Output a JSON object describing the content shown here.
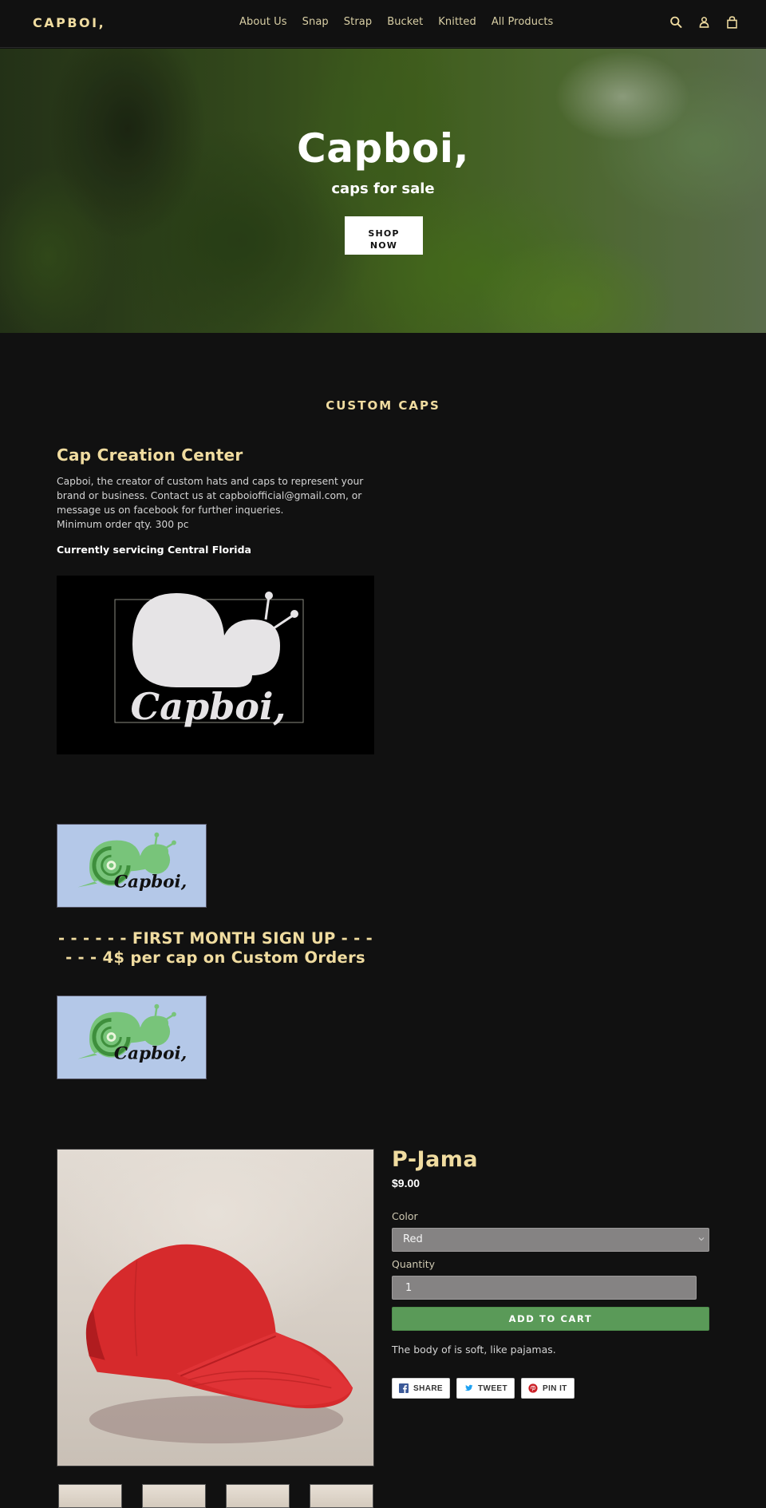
{
  "header": {
    "logo": "CAPBOI,",
    "nav": [
      "About Us",
      "Snap",
      "Strap",
      "Bucket",
      "Knitted",
      "All Products"
    ],
    "icons": [
      "search-icon",
      "account-icon",
      "cart-icon"
    ]
  },
  "hero": {
    "title": "Capboi,",
    "subtitle": "caps for sale",
    "button_line1": "SHOP",
    "button_line2": "NOW"
  },
  "custom_caps": {
    "heading": "CUSTOM CAPS",
    "title": "Cap Creation Center",
    "body_line1": "Capboi, the creator of custom hats and caps to represent your brand or business. Contact us at capboiofficial@gmail.com, or message us on facebook for further inqueries.",
    "body_line2": "Minimum order qty. 300 pc",
    "strong": "Currently servicing Central Florida",
    "logo_text": "Capboi,",
    "promo": "- - - - - - FIRST MONTH SIGN UP - - - - - - 4$ per cap on Custom Orders"
  },
  "product": {
    "title": "P-Jama",
    "price": "$9.00",
    "color_label": "Color",
    "color_value": "Red",
    "quantity_label": "Quantity",
    "quantity_value": "1",
    "add_to_cart": "ADD TO CART",
    "description": "The body of is soft, like pajamas.",
    "share": {
      "facebook": "SHARE",
      "twitter": "TWEET",
      "pinterest": "PIN IT"
    },
    "thumbnail_count": 4
  },
  "colors": {
    "accent": "#f0dca0",
    "background": "#111111",
    "add_to_cart": "#5a9a58",
    "facebook": "#3b5998",
    "twitter": "#1da1f2",
    "pinterest": "#cb2027"
  }
}
